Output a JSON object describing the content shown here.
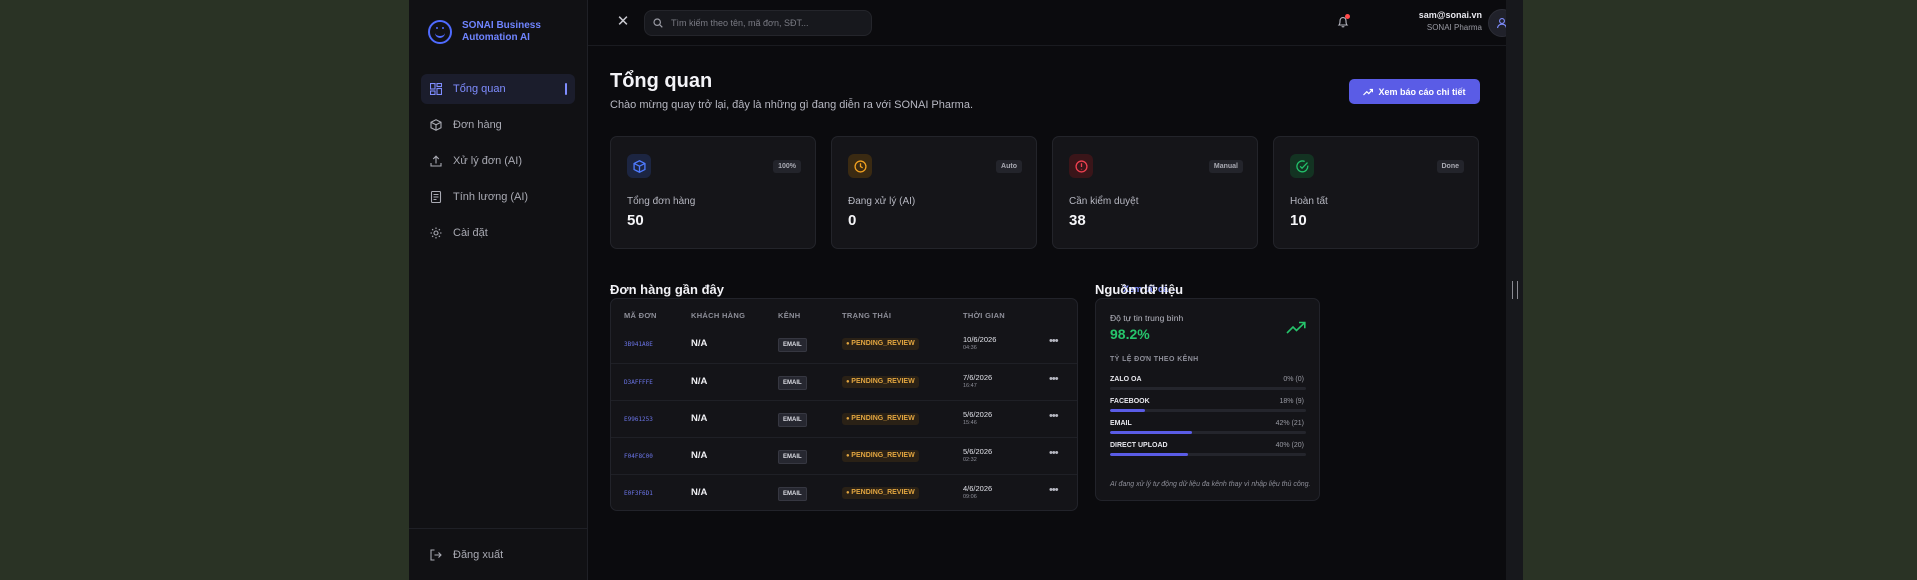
{
  "brand": {
    "line1": "SONAI Business",
    "line2": "Automation AI"
  },
  "sidebar": {
    "items": [
      {
        "label": "Tổng quan",
        "icon": "dashboard-icon",
        "active": true
      },
      {
        "label": "Đơn hàng",
        "icon": "box-icon",
        "active": false
      },
      {
        "label": "Xử lý đơn (AI)",
        "icon": "upload-icon",
        "active": false
      },
      {
        "label": "Tính lương (AI)",
        "icon": "document-icon",
        "active": false
      },
      {
        "label": "Cài đặt",
        "icon": "gear-icon",
        "active": false
      }
    ],
    "logout_label": "Đăng xuất"
  },
  "topbar": {
    "search_placeholder": "Tìm kiếm theo tên, mã đơn, SĐT...",
    "user_email": "sam@sonai.vn",
    "user_org": "SONAI Pharma"
  },
  "header": {
    "title": "Tổng quan",
    "subtitle": "Chào mừng quay trở lại, đây là những gì đang diễn ra với SONAI Pharma.",
    "report_button": "Xem báo cáo chi tiết"
  },
  "stats": [
    {
      "label": "Tổng đơn hàng",
      "value": "50",
      "badge": "100%",
      "icon": "cube-icon",
      "color": "#4f7bff"
    },
    {
      "label": "Đang xử lý (AI)",
      "value": "0",
      "badge": "Auto",
      "icon": "clock-icon",
      "color": "#f0a020"
    },
    {
      "label": "Cần kiểm duyệt",
      "value": "38",
      "badge": "Manual",
      "icon": "alert-icon",
      "color": "#ef4050"
    },
    {
      "label": "Hoàn tất",
      "value": "10",
      "badge": "Done",
      "icon": "check-circle-icon",
      "color": "#22c06a"
    }
  ],
  "orders": {
    "title": "Đơn hàng gần đây",
    "see_all": "Xem tất cả →",
    "columns": [
      "MÃ ĐƠN",
      "KHÁCH HÀNG",
      "KÊNH",
      "TRẠNG THÁI",
      "THỜI GIAN"
    ],
    "rows": [
      {
        "id": "3B941A8E",
        "customer": "N/A",
        "channel": "EMAIL",
        "status": "PENDING_REVIEW",
        "date": "10/6/2026",
        "time": "04:36"
      },
      {
        "id": "D3AFFFFE",
        "customer": "N/A",
        "channel": "EMAIL",
        "status": "PENDING_REVIEW",
        "date": "7/6/2026",
        "time": "16:47"
      },
      {
        "id": "E9961253",
        "customer": "N/A",
        "channel": "EMAIL",
        "status": "PENDING_REVIEW",
        "date": "5/6/2026",
        "time": "15:46"
      },
      {
        "id": "F04F8C00",
        "customer": "N/A",
        "channel": "EMAIL",
        "status": "PENDING_REVIEW",
        "date": "5/6/2026",
        "time": "02:32"
      },
      {
        "id": "E0F3F6D1",
        "customer": "N/A",
        "channel": "EMAIL",
        "status": "PENDING_REVIEW",
        "date": "4/6/2026",
        "time": "09:06"
      }
    ]
  },
  "sources": {
    "title": "Nguồn dữ liệu",
    "confidence_label": "Độ tự tin trung bình",
    "confidence_value": "98.2%",
    "ratio_title": "TỶ LỆ ĐƠN THEO KÊNH",
    "channels": [
      {
        "name": "ZALO OA",
        "value": "0% (0)",
        "percent": 0
      },
      {
        "name": "FACEBOOK",
        "value": "18% (9)",
        "percent": 18
      },
      {
        "name": "EMAIL",
        "value": "42% (21)",
        "percent": 42
      },
      {
        "name": "DIRECT UPLOAD",
        "value": "40% (20)",
        "percent": 40
      }
    ],
    "note": "AI đang xử lý tự động dữ liệu đa kênh thay vì nhập liệu thủ công."
  }
}
